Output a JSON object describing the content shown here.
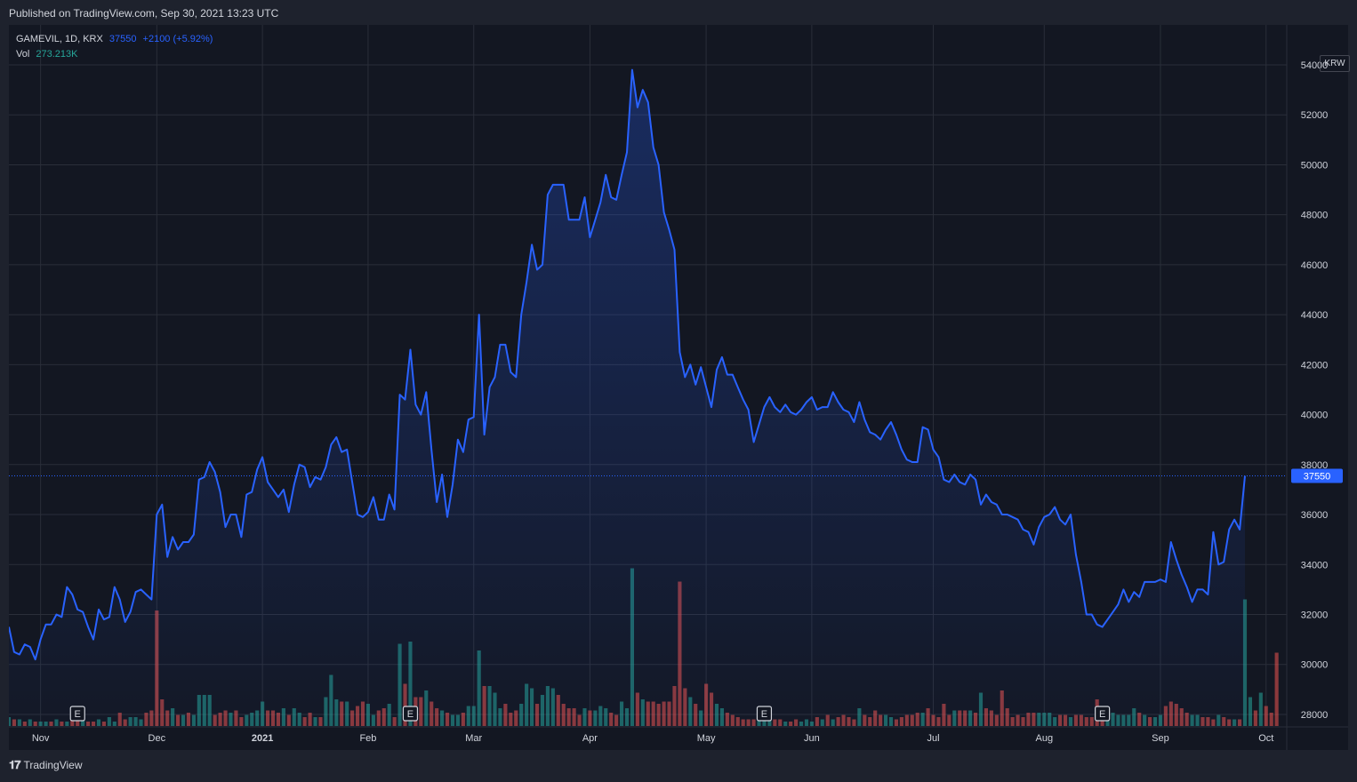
{
  "header": {
    "published": "Published on TradingView.com, Sep 30, 2021 13:23 UTC"
  },
  "legend": {
    "symbol": "GAMEVIL, 1D, KRX",
    "last": "37550",
    "change": "+2100 (+5.92%)",
    "vol_label": "Vol",
    "vol_value": "273.213K"
  },
  "currency": "KRW",
  "footer": {
    "brand": "TradingView",
    "logo_icon": "tradingview-logo-icon"
  },
  "colors": {
    "line": "#2962ff",
    "up": "#26a69a",
    "down": "#ef5350",
    "grid": "#2a2e39",
    "bg": "#131722"
  },
  "chart_data": {
    "type": "area",
    "title": "",
    "series": [
      {
        "name": "GAMEVIL",
        "values": [
          31500,
          30500,
          30400,
          30800,
          30700,
          30200,
          31000,
          31600,
          31600,
          32000,
          31900,
          33100,
          32800,
          32200,
          32100,
          31500,
          31000,
          32200,
          31800,
          31900,
          33100,
          32600,
          31700,
          32100,
          32900,
          33000,
          32800,
          32600,
          36000,
          36400,
          34300,
          35100,
          34600,
          34900,
          34900,
          35200,
          37400,
          37500,
          38100,
          37700,
          36900,
          35500,
          36000,
          36000,
          35100,
          36800,
          36900,
          37800,
          38300,
          37300,
          37000,
          36700,
          37000,
          36100,
          37200,
          38000,
          37900,
          37100,
          37500,
          37400,
          37900,
          38800,
          39100,
          38500,
          38600,
          37300,
          36000,
          35900,
          36100,
          36700,
          35800,
          35800,
          36800,
          36200,
          40800,
          40600,
          42600,
          40400,
          40000,
          40900,
          38600,
          36500,
          37600,
          35900,
          37200,
          39000,
          38500,
          39800,
          39900,
          44000,
          39200,
          41100,
          41500,
          42800,
          42800,
          41700,
          41500,
          44000,
          45300,
          46800,
          45800,
          46000,
          48800,
          49200,
          49200,
          49200,
          47800,
          47800,
          47800,
          48700,
          47100,
          47800,
          48500,
          49600,
          48700,
          48600,
          49600,
          50500,
          53800,
          52300,
          53000,
          52500,
          50700,
          50000,
          48100,
          47400,
          46600,
          42500,
          41500,
          42000,
          41200,
          41900,
          41100,
          40300,
          41800,
          42300,
          41600,
          41600,
          41100,
          40600,
          40200,
          38900,
          39600,
          40300,
          40700,
          40300,
          40100,
          40400,
          40100,
          40000,
          40200,
          40500,
          40700,
          40200,
          40300,
          40300,
          40900,
          40500,
          40200,
          40100,
          39700,
          40500,
          39800,
          39300,
          39200,
          39000,
          39400,
          39700,
          39200,
          38600,
          38200,
          38100,
          38100,
          39500,
          39400,
          38600,
          38300,
          37400,
          37300,
          37600,
          37300,
          37200,
          37600,
          37400,
          36400,
          36800,
          36500,
          36400,
          36000,
          36000,
          35900,
          35800,
          35400,
          35300,
          34800,
          35500,
          35900,
          36000,
          36300,
          35800,
          35600,
          36000,
          34400,
          33300,
          32000,
          32000,
          31600,
          31500,
          31800,
          32100,
          32400,
          33000,
          32500,
          32900,
          32700,
          33300,
          33300,
          33300,
          33400,
          33300,
          34900,
          34200,
          33600,
          33100,
          32500,
          33000,
          33000,
          32800,
          35300,
          34000,
          34100,
          35400,
          35800,
          35400,
          37550
        ]
      }
    ],
    "volume": {
      "name": "Vol",
      "values": [
        0.4,
        0.3,
        0.3,
        0.2,
        0.3,
        0.2,
        0.2,
        0.2,
        0.2,
        0.3,
        0.2,
        0.2,
        0.3,
        0.4,
        0.8,
        0.2,
        0.2,
        0.3,
        0.2,
        0.4,
        0.2,
        0.6,
        0.3,
        0.4,
        0.4,
        0.3,
        0.6,
        0.7,
        5.2,
        1.2,
        0.7,
        0.8,
        0.5,
        0.5,
        0.6,
        0.5,
        1.4,
        1.4,
        1.4,
        0.5,
        0.6,
        0.7,
        0.6,
        0.7,
        0.4,
        0.5,
        0.6,
        0.7,
        1.1,
        0.7,
        0.7,
        0.6,
        0.8,
        0.5,
        0.8,
        0.6,
        0.4,
        0.6,
        0.4,
        0.4,
        1.3,
        2.3,
        1.2,
        1.1,
        1.1,
        0.7,
        0.9,
        1.1,
        1.0,
        0.5,
        0.7,
        0.8,
        1.0,
        0.4,
        3.7,
        1.9,
        3.8,
        1.3,
        1.3,
        1.6,
        1.1,
        0.8,
        0.7,
        0.6,
        0.5,
        0.5,
        0.6,
        0.9,
        0.9,
        3.4,
        1.8,
        1.8,
        1.5,
        0.8,
        1.0,
        0.6,
        0.7,
        1.0,
        1.9,
        1.7,
        1.0,
        1.4,
        1.8,
        1.7,
        1.4,
        1.0,
        0.8,
        0.8,
        0.5,
        0.8,
        0.7,
        0.7,
        0.9,
        0.8,
        0.6,
        0.5,
        1.1,
        0.8,
        7.1,
        1.5,
        1.2,
        1.1,
        1.1,
        1.0,
        1.1,
        1.1,
        1.8,
        6.5,
        1.7,
        1.3,
        1.0,
        0.7,
        1.9,
        1.5,
        1.0,
        0.8,
        0.6,
        0.5,
        0.4,
        0.3,
        0.3,
        0.3,
        0.3,
        0.3,
        0.4,
        0.3,
        0.3,
        0.2,
        0.2,
        0.3,
        0.2,
        0.3,
        0.2,
        0.4,
        0.3,
        0.5,
        0.3,
        0.4,
        0.5,
        0.4,
        0.3,
        0.8,
        0.5,
        0.4,
        0.7,
        0.5,
        0.5,
        0.4,
        0.3,
        0.4,
        0.5,
        0.5,
        0.6,
        0.6,
        0.8,
        0.5,
        0.4,
        1.0,
        0.5,
        0.7,
        0.7,
        0.7,
        0.7,
        0.6,
        1.5,
        0.8,
        0.7,
        0.5,
        1.6,
        0.8,
        0.4,
        0.5,
        0.4,
        0.6,
        0.6,
        0.6,
        0.6,
        0.6,
        0.4,
        0.5,
        0.5,
        0.4,
        0.5,
        0.5,
        0.4,
        0.4,
        1.2,
        0.9,
        0.5,
        0.6,
        0.5,
        0.5,
        0.5,
        0.8,
        0.6,
        0.5,
        0.4,
        0.4,
        0.5,
        0.9,
        1.1,
        1.0,
        0.8,
        0.6,
        0.5,
        0.5,
        0.4,
        0.4,
        0.3,
        0.5,
        0.4,
        0.3,
        0.3,
        0.3,
        5.7,
        1.3,
        0.7,
        1.5,
        0.9,
        0.6,
        3.3
      ],
      "up": [
        true,
        false,
        true,
        false,
        true,
        false,
        true,
        true,
        false,
        true,
        false,
        true,
        false,
        false,
        true,
        false,
        false,
        true,
        false,
        true,
        true,
        false,
        false,
        true,
        true,
        true,
        false,
        false,
        false,
        false,
        false,
        true,
        false,
        true,
        false,
        true,
        true,
        true,
        true,
        false,
        false,
        false,
        true,
        false,
        false,
        true,
        true,
        true,
        true,
        false,
        false,
        false,
        true,
        false,
        true,
        true,
        false,
        false,
        true,
        false,
        true,
        true,
        true,
        false,
        true,
        false,
        false,
        false,
        true,
        true,
        false,
        false,
        true,
        false,
        true,
        false,
        true,
        false,
        false,
        true,
        false,
        false,
        true,
        false,
        true,
        true,
        false,
        true,
        true,
        true,
        false,
        true,
        true,
        true,
        false,
        false,
        false,
        true,
        true,
        true,
        false,
        true,
        true,
        true,
        false,
        false,
        false,
        false,
        false,
        true,
        false,
        true,
        true,
        true,
        false,
        false,
        true,
        true,
        true,
        false,
        true,
        false,
        false,
        false,
        false,
        false,
        false,
        false,
        false,
        true,
        false,
        true,
        false,
        false,
        true,
        true,
        false,
        false,
        false,
        false,
        false,
        false,
        true,
        true,
        true,
        false,
        false,
        true,
        false,
        false,
        true,
        true,
        true,
        false,
        true,
        false,
        true,
        false,
        false,
        false,
        false,
        true,
        false,
        false,
        false,
        false,
        true,
        true,
        false,
        false,
        false,
        false,
        false,
        true,
        false,
        false,
        false,
        false,
        false,
        true,
        false,
        false,
        true,
        false,
        true,
        false,
        false,
        false,
        false,
        false,
        false,
        false,
        false,
        false,
        false,
        true,
        true,
        true,
        true,
        false,
        false,
        true,
        false,
        false,
        false,
        false,
        false,
        false,
        true,
        true,
        true,
        true,
        true,
        true,
        false,
        true,
        false,
        true,
        true,
        false,
        false,
        false,
        false,
        false,
        true,
        true,
        false,
        false,
        false,
        true,
        false,
        false,
        true,
        false,
        true,
        true,
        false,
        true
      ],
      "ylim": [
        0,
        8
      ]
    },
    "last_value": 37550,
    "last_label": "37550",
    "ylim": [
      27500,
      55600
    ],
    "y_ticks": [
      28000,
      30000,
      32000,
      34000,
      36000,
      38000,
      40000,
      42000,
      44000,
      46000,
      48000,
      50000,
      52000,
      54000
    ],
    "y_tick_labels": [
      "28000",
      "30000",
      "32000",
      "34000",
      "36000",
      "38000",
      "40000",
      "42000",
      "44000",
      "46000",
      "48000",
      "50000",
      "52000",
      "54000"
    ],
    "x_ticks": [
      {
        "label": "Nov",
        "index": 6,
        "bold": false
      },
      {
        "label": "Dec",
        "index": 28,
        "bold": false
      },
      {
        "label": "2021",
        "index": 48,
        "bold": true
      },
      {
        "label": "Feb",
        "index": 68,
        "bold": false
      },
      {
        "label": "Mar",
        "index": 88,
        "bold": false
      },
      {
        "label": "Apr",
        "index": 110,
        "bold": false
      },
      {
        "label": "May",
        "index": 132,
        "bold": false
      },
      {
        "label": "Jun",
        "index": 152,
        "bold": false
      },
      {
        "label": "Jul",
        "index": 175,
        "bold": false
      },
      {
        "label": "Aug",
        "index": 196,
        "bold": false
      },
      {
        "label": "Sep",
        "index": 218,
        "bold": false
      },
      {
        "label": "Oct",
        "index": 238,
        "bold": false
      }
    ],
    "earnings_markers": [
      {
        "label": "E",
        "index": 13
      },
      {
        "label": "E",
        "index": 76
      },
      {
        "label": "E",
        "index": 143
      },
      {
        "label": "E",
        "index": 207
      }
    ],
    "grid": true,
    "legend": "top-left"
  }
}
